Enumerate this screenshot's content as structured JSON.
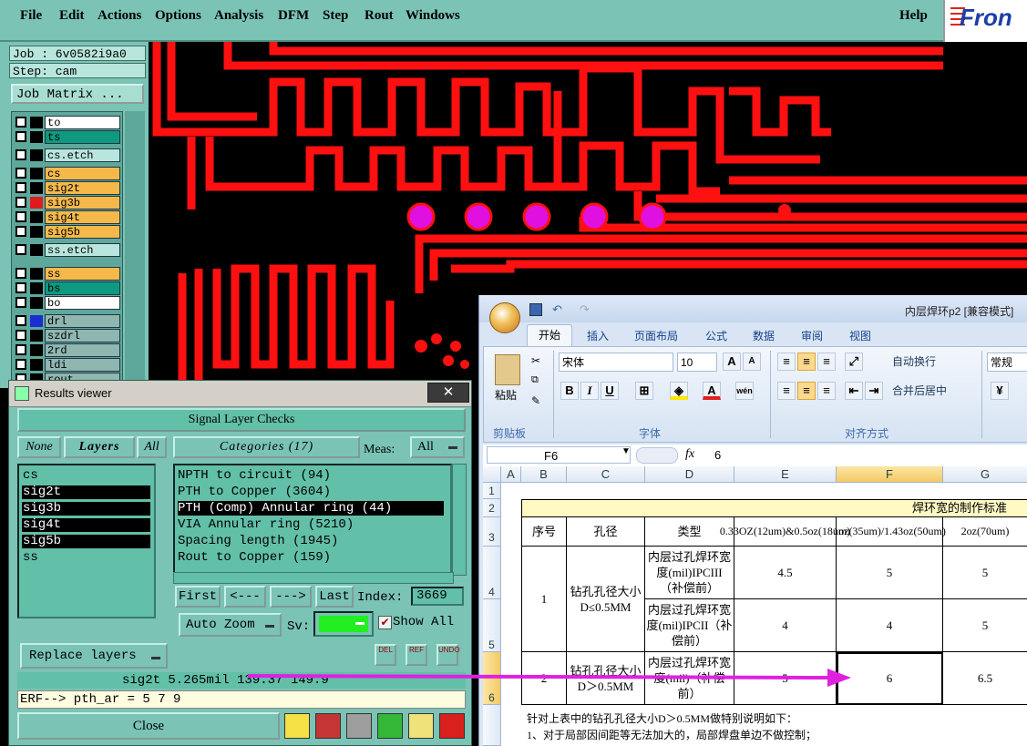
{
  "menu": {
    "items": [
      "File",
      "Edit",
      "Actions",
      "Options",
      "Analysis",
      "DFM",
      "Step",
      "Rout",
      "Windows"
    ],
    "help": "Help"
  },
  "logo": {
    "text": "Fron"
  },
  "job": {
    "job_label": "Job : 6v0582i9a0",
    "step_label": "Step: cam",
    "matrix_button": "Job Matrix ..."
  },
  "layers": [
    {
      "name": "to",
      "bg": "#ffffff"
    },
    {
      "name": "ts",
      "bg": "#0d9a80"
    },
    {
      "name": "cs.etch",
      "bg": "#b9e6dc"
    },
    {
      "name": "cs",
      "bg": "#f5b94a"
    },
    {
      "name": "sig2t",
      "bg": "#f5b94a"
    },
    {
      "name": "sig3b",
      "bg": "#f5b94a"
    },
    {
      "name": "sig4t",
      "bg": "#f5b94a"
    },
    {
      "name": "sig5b",
      "bg": "#f5b94a"
    },
    {
      "name": "ss.etch",
      "bg": "#b9e6dc"
    },
    {
      "name": "ss",
      "bg": "#f5b94a"
    },
    {
      "name": "bs",
      "bg": "#0d9a80"
    },
    {
      "name": "bo",
      "bg": "#ffffff"
    },
    {
      "name": "drl",
      "bg": "#8fb7b0"
    },
    {
      "name": "szdrl",
      "bg": "#8fb7b0"
    },
    {
      "name": "2rd",
      "bg": "#8fb7b0"
    },
    {
      "name": "ldi",
      "bg": "#8fb7b0"
    },
    {
      "name": "rout",
      "bg": "#8fb7b0"
    }
  ],
  "results_viewer": {
    "title": "Results viewer",
    "close_x": "✕",
    "header": "Signal Layer Checks",
    "none_btn": "None",
    "layers_btn": "Layers",
    "all_btn": "All",
    "categories_btn": "Categories (17)",
    "meas_label": "Meas:",
    "meas_value": "All",
    "layer_items": [
      {
        "name": "cs",
        "selected": false
      },
      {
        "name": "sig2t",
        "selected": true
      },
      {
        "name": "sig3b",
        "selected": true
      },
      {
        "name": "sig4t",
        "selected": true
      },
      {
        "name": "sig5b",
        "selected": true
      },
      {
        "name": "ss",
        "selected": false
      }
    ],
    "categories": [
      {
        "label": "NPTH to circuit (94)",
        "selected": false
      },
      {
        "label": "PTH to Copper (3604)",
        "selected": false
      },
      {
        "label": "PTH (Comp) Annular ring (44)",
        "selected": true
      },
      {
        "label": "VIA Annular ring (5210)",
        "selected": false
      },
      {
        "label": "Spacing length (1945)",
        "selected": false
      },
      {
        "label": "Rout to Copper (159)",
        "selected": false
      }
    ],
    "first_btn": "First",
    "prev_btn": "<---",
    "next_btn": "--->",
    "last_btn": "Last",
    "index_label": "Index:",
    "index_value": "3669",
    "autozoom_btn": "Auto Zoom",
    "sv_label": "Sv:",
    "show_all_label": "Show All",
    "replace_btn": "Replace layers",
    "status_line": "sig2t 5.265mil  139.37  149.9",
    "erf_line": "ERF--> pth_ar = 5 7 9",
    "close_btn": "Close",
    "del_label": "DEL",
    "ref_label": "REF",
    "undo_label": "UNDO"
  },
  "excel": {
    "title": "内层焊环p2  [兼容模式]",
    "tabs": [
      "开始",
      "插入",
      "页面布局",
      "公式",
      "数据",
      "审阅",
      "视图"
    ],
    "clipboard": {
      "paste": "粘贴",
      "group": "剪贴板"
    },
    "font": {
      "name": "宋体",
      "size": "10",
      "group": "字体"
    },
    "alignment": {
      "wrap": "自动换行",
      "merge": "合并后居中",
      "group": "对齐方式"
    },
    "number": {
      "format": "常规"
    },
    "name_box": "F6",
    "formula_value": "6",
    "columns": [
      "A",
      "B",
      "C",
      "D",
      "E",
      "F",
      "G"
    ],
    "rows": [
      "1",
      "2",
      "3",
      "4",
      "5",
      "6"
    ],
    "table": {
      "title": "焊环宽的制作标准",
      "headers": [
        "序号",
        "孔径",
        "类型",
        "0.33OZ(12um)&0.5oz(18um)",
        "1oz(35um)/1.43oz(50um)",
        "2oz(70um)"
      ],
      "rows": [
        {
          "no": "1",
          "hole": "钻孔孔径大小D≤0.5MM",
          "type": "内层过孔焊环宽度(mil)IPCIII（补偿前）",
          "e": "4.5",
          "f": "5",
          "g": "5"
        },
        {
          "no": "",
          "hole": "",
          "type": "内层过孔焊环宽度(mil)IPCII（补偿前）",
          "e": "4",
          "f": "4",
          "g": "5"
        },
        {
          "no": "2",
          "hole": "钻孔孔径大小D＞0.5MM",
          "type": "内层过孔焊环宽度(mil)（补偿前）",
          "e": "5",
          "f": "6",
          "g": "6.5"
        }
      ],
      "note1": "针对上表中的钻孔孔径大小D＞0.5MM做特别说明如下：",
      "note2": "1、对于局部因间距等无法加大的，局部焊盘单边不做控制；"
    }
  }
}
